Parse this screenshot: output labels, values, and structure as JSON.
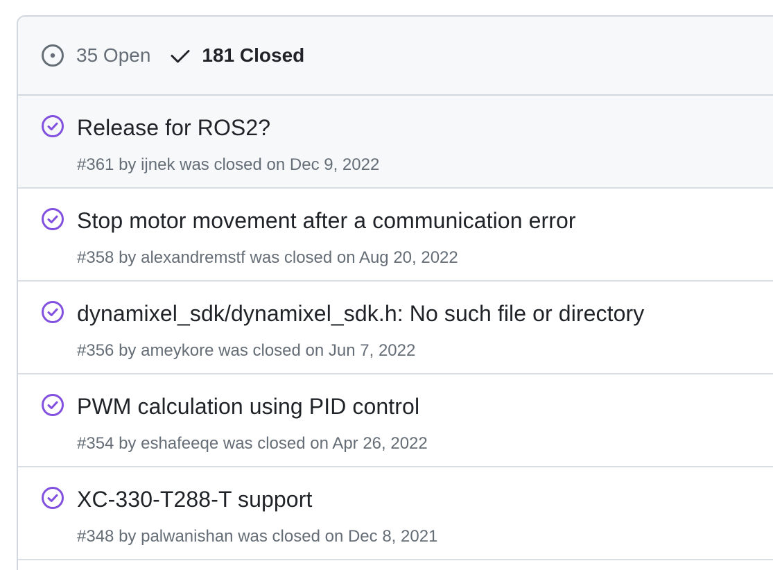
{
  "filters": {
    "open_label": "35 Open",
    "closed_label": "181 Closed"
  },
  "colors": {
    "closed_icon": "#8250df",
    "muted": "#656d76",
    "border": "#d0d7de",
    "header_bg": "#f6f8fa"
  },
  "issues": [
    {
      "title": "Release for ROS2?",
      "number": "#361",
      "by": "by",
      "author": "ijnek",
      "closed_text": "was closed on",
      "date": "Dec 9, 2022",
      "icon": "issue-closed-icon"
    },
    {
      "title": "Stop motor movement after a communication error",
      "number": "#358",
      "by": "by",
      "author": "alexandremstf",
      "closed_text": "was closed on",
      "date": "Aug 20, 2022",
      "icon": "issue-closed-icon"
    },
    {
      "title": "dynamixel_sdk/dynamixel_sdk.h: No such file or directory",
      "number": "#356",
      "by": "by",
      "author": "ameykore",
      "closed_text": "was closed on",
      "date": "Jun 7, 2022",
      "icon": "issue-closed-icon"
    },
    {
      "title": "PWM calculation using PID control",
      "number": "#354",
      "by": "by",
      "author": "eshafeeqe",
      "closed_text": "was closed on",
      "date": "Apr 26, 2022",
      "icon": "issue-closed-icon"
    },
    {
      "title": "XC-330-T288-T support",
      "number": "#348",
      "by": "by",
      "author": "palwanishan",
      "closed_text": "was closed on",
      "date": "Dec 8, 2021",
      "icon": "issue-closed-icon"
    }
  ]
}
